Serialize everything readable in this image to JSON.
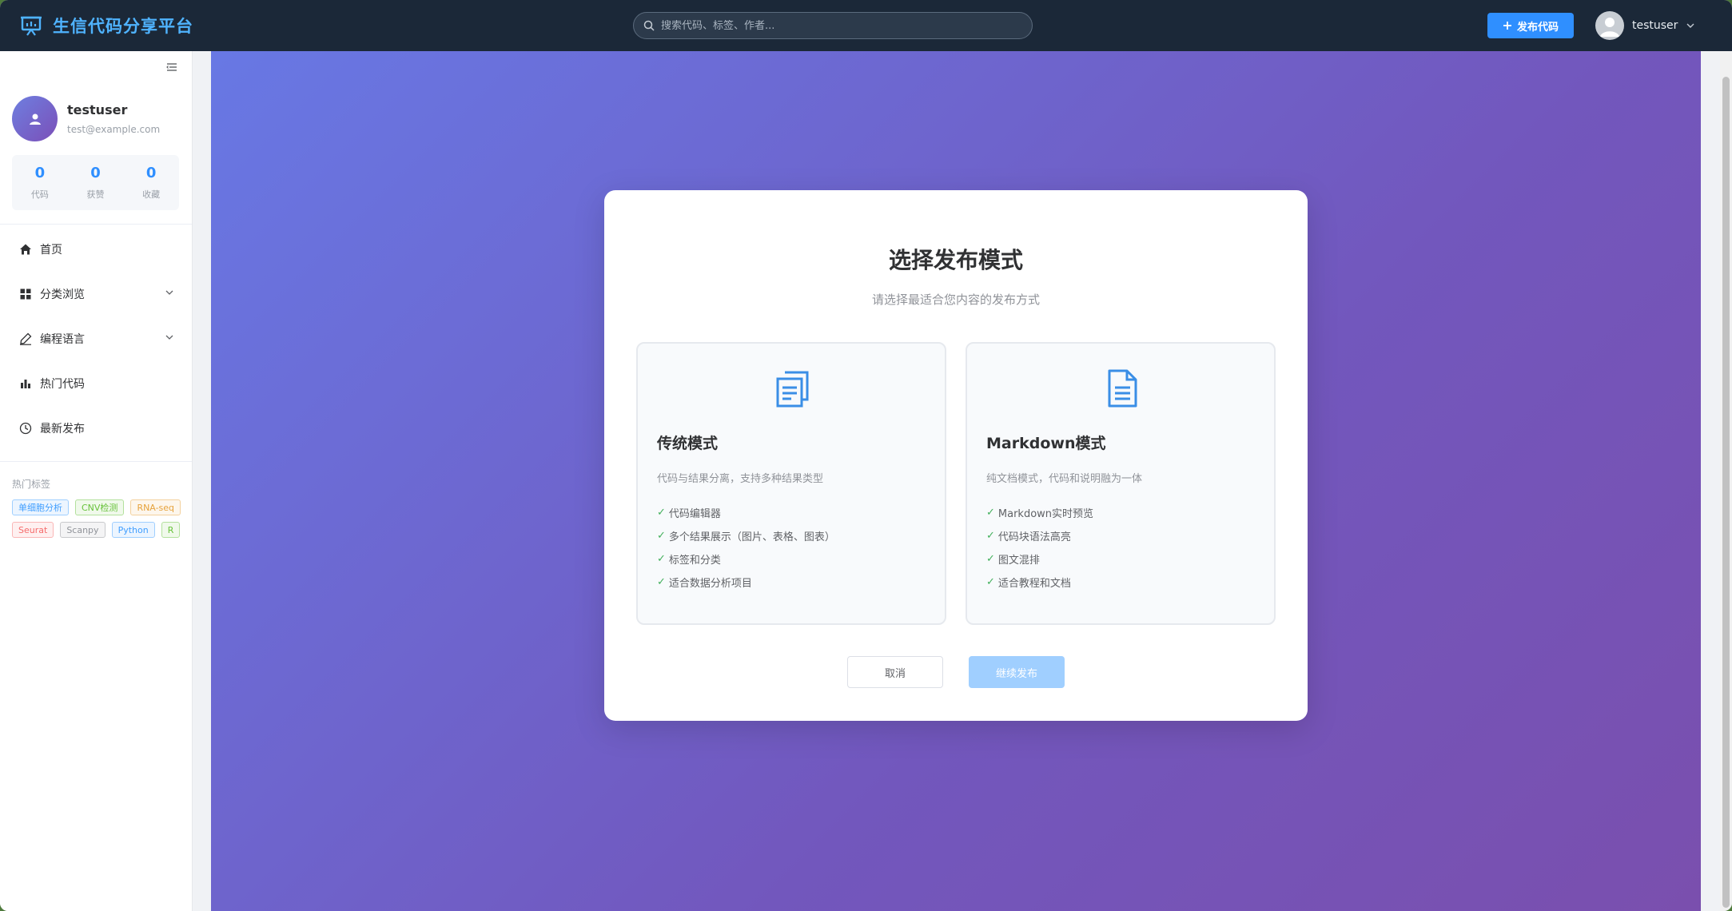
{
  "header": {
    "logo_text": "生信代码分享平台",
    "search_placeholder": "搜索代码、标签、作者...",
    "publish_label": "发布代码",
    "username": "testuser"
  },
  "sidebar": {
    "profile": {
      "name": "testuser",
      "email": "test@example.com"
    },
    "stats": [
      {
        "value": "0",
        "label": "代码"
      },
      {
        "value": "0",
        "label": "获赞"
      },
      {
        "value": "0",
        "label": "收藏"
      }
    ],
    "nav": [
      {
        "label": "首页",
        "icon": "home-icon"
      },
      {
        "label": "分类浏览",
        "icon": "grid-icon",
        "expandable": true
      },
      {
        "label": "编程语言",
        "icon": "pen-icon",
        "expandable": true
      },
      {
        "label": "热门代码",
        "icon": "bar-chart-icon"
      },
      {
        "label": "最新发布",
        "icon": "clock-icon"
      }
    ],
    "tags_title": "热门标签",
    "tags": [
      {
        "label": "单细胞分析",
        "color": "#409eff"
      },
      {
        "label": "CNV检测",
        "color": "#67c23a"
      },
      {
        "label": "RNA-seq",
        "color": "#e6a23c"
      },
      {
        "label": "Seurat",
        "color": "#f56c6c"
      },
      {
        "label": "Scanpy",
        "color": "#909399"
      },
      {
        "label": "Python",
        "color": "#409eff"
      },
      {
        "label": "R",
        "color": "#67c23a"
      }
    ]
  },
  "modal": {
    "title": "选择发布模式",
    "subtitle": "请选择最适合您内容的发布方式",
    "modes": [
      {
        "title": "传统模式",
        "desc": "代码与结果分离，支持多种结果类型",
        "icon": "copy-document-icon",
        "features": [
          "代码编辑器",
          "多个结果展示（图片、表格、图表）",
          "标签和分类",
          "适合数据分析项目"
        ]
      },
      {
        "title": "Markdown模式",
        "desc": "纯文档模式，代码和说明融为一体",
        "icon": "document-icon",
        "features": [
          "Markdown实时预览",
          "代码块语法高亮",
          "图文混排",
          "适合教程和文档"
        ]
      }
    ],
    "cancel_label": "取消",
    "continue_label": "继续发布"
  },
  "colors": {
    "accent": "#2f8fff",
    "header_bg": "#1b2838",
    "check": "#43b05c"
  }
}
